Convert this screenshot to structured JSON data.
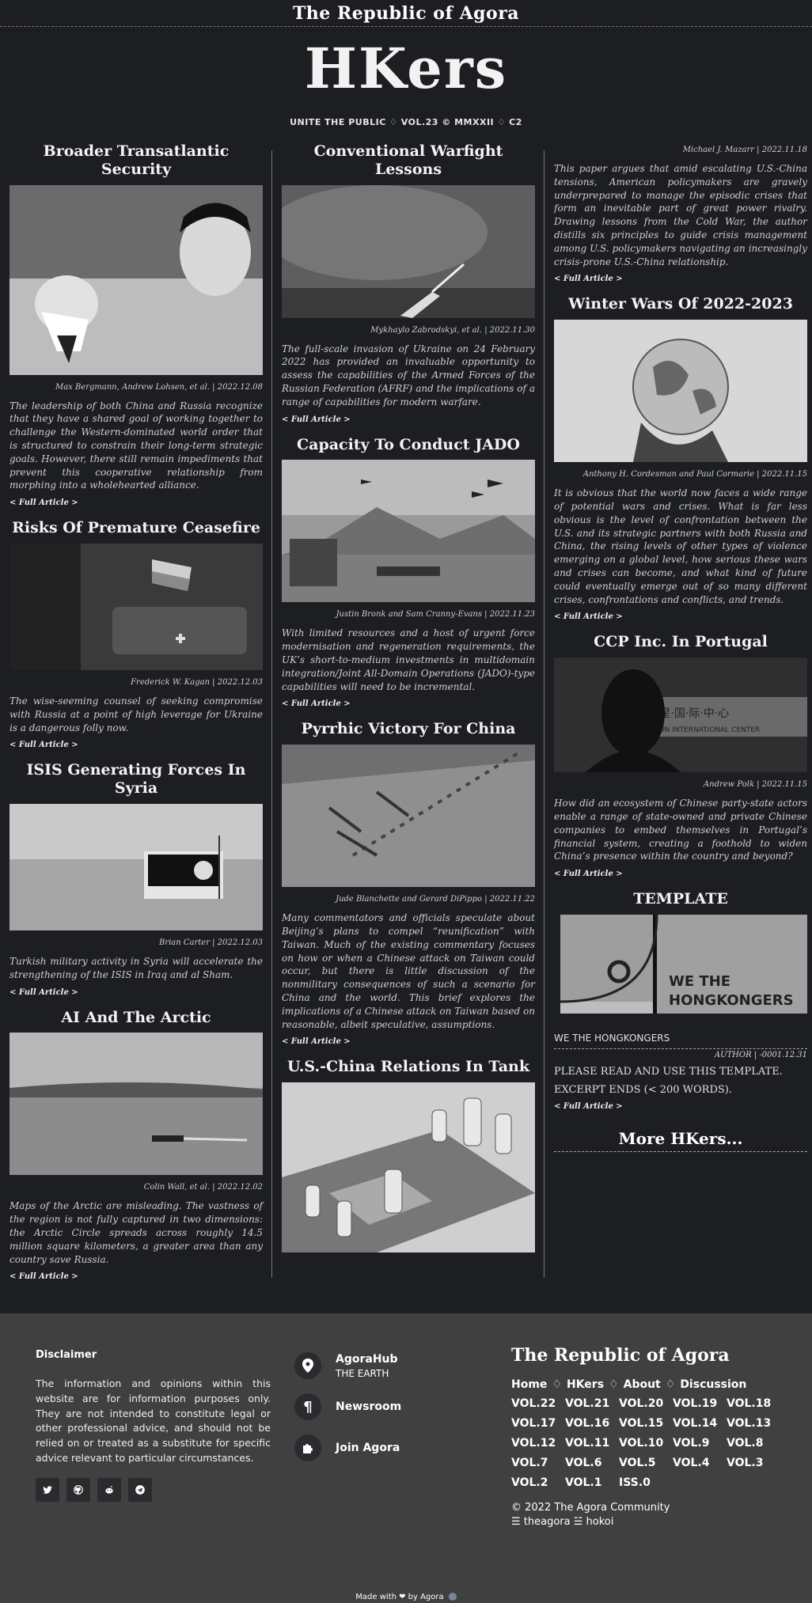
{
  "site": {
    "brand": "The Republic of Agora",
    "logo": "HKers",
    "subtitle": "UNITE THE PUBLIC ♢ VOL.23 © MMXXII ♢ C2"
  },
  "articles": {
    "a1": {
      "title": "Broader Transatlantic Security",
      "byline": "Max Bergmann, Andrew Lohsen, et al. | 2022.12.08",
      "abstract": "The leadership of both China and Russia recognize that they have a shared goal of working together to challenge the Western-dominated world order that is structured to constrain their long-term strategic goals. However, there still remain impediments that prevent this cooperative relationship from morphing into a wholehearted alliance.",
      "more": "< Full Article >"
    },
    "a2": {
      "title": "Risks Of Premature Ceasefire",
      "byline": "Frederick W. Kagan | 2022.12.03",
      "abstract": "The wise-seeming counsel of seeking compromise with Russia at a point of high leverage for Ukraine is a dangerous folly now.",
      "more": "< Full Article >"
    },
    "a3": {
      "title": "ISIS Generating Forces In Syria",
      "byline": "Brian Carter | 2022.12.03",
      "abstract": "Turkish military activity in Syria will accelerate the strengthening of the ISIS in Iraq and al Sham.",
      "more": "< Full Article >"
    },
    "a4": {
      "title": "AI And The Arctic",
      "byline": "Colin Wall, et al. | 2022.12.02",
      "abstract": "Maps of the Arctic are misleading. The vastness of the region is not fully captured in two dimensions: the Arctic Circle spreads across roughly 14.5 million square kilometers, a greater area than any country save Russia.",
      "more": "< Full Article >"
    },
    "b1": {
      "title": "Conventional Warfight Lessons",
      "byline": "Mykhaylo Zabrodskyi, et al. | 2022.11.30",
      "abstract": "The full-scale invasion of Ukraine on 24 February 2022 has provided an invaluable opportunity to assess the capabilities of the Armed Forces of the Russian Federation (AFRF) and the implications of a range of capabilities for modern warfare.",
      "more": "< Full Article >"
    },
    "b2": {
      "title": "Capacity To Conduct JADO",
      "byline": "Justin Bronk and Sam Cranny-Evans | 2022.11.23",
      "abstract": "With limited resources and a host of urgent force modernisation and regeneration requirements, the UK’s short-to-medium investments in multidomain integration/Joint All-Domain Operations (JADO)-type capabilities will need to be incremental.",
      "more": "< Full Article >"
    },
    "b3": {
      "title": "Pyrrhic Victory For China",
      "byline": "Jude Blanchette and Gerard DiPippo | 2022.11.22",
      "abstract": "Many commentators and officials speculate about Beijing’s plans to compel “reunification” with Taiwan. Much of the existing commentary focuses on how or when a Chinese attack on Taiwan could occur, but there is little discussion of the nonmilitary consequences of such a scenario for China and the world. This brief explores the implications of a Chinese attack on Taiwan based on reasonable, albeit speculative, assumptions.",
      "more": "< Full Article >"
    },
    "b4": {
      "title": "U.S.-China Relations In Tank"
    },
    "c0": {
      "byline": "Michael J. Mazarr | 2022.11.18",
      "abstract": "This paper argues that amid escalating U.S.-China tensions, American policymakers are gravely underprepared to manage the episodic crises that form an inevitable part of great power rivalry. Drawing lessons from the Cold War, the author distills six principles to guide crisis management among U.S. policymakers navigating an increasingly crisis-prone U.S.-China relationship.",
      "more": "< Full Article >"
    },
    "c1": {
      "title": "Winter Wars Of 2022-2023",
      "byline": "Anthony H. Cordesman and Paul Cormarie | 2022.11.15",
      "abstract": "It is obvious that the world now faces a wide range of potential wars and crises. What is far less obvious is the level of confrontation between the U.S. and its strategic partners with both Russia and China, the rising levels of other types of violence emerging on a global level, how serious these wars and crises can become, and what kind of future could eventually emerge out of so many different crises, confrontations and conflicts, and trends.",
      "more": "< Full Article >"
    },
    "c2": {
      "title": "CCP Inc. In Portugal",
      "byline": "Andrew Polk | 2022.11.15",
      "abstract": "How did an ecosystem of Chinese party-state actors enable a range of state-owned and private Chinese companies to embed themselves in Portugal’s financial system, creating a foothold to widen China’s presence within the country and beyond?",
      "more": "< Full Article >",
      "sign_cn": "复·星·国·际·中·心",
      "sign_en": "FOSUN INTERNATIONAL CENTER"
    },
    "c3": {
      "title": "TEMPLATE",
      "banner_line1": "WE THE",
      "banner_line2": "HONGKONGERS",
      "caption": "WE THE HONGKONGERS",
      "byline": "AUTHOR | -0001.12.31",
      "p1": "PLEASE READ AND USE THIS TEMPLATE.",
      "p2": "EXCERPT ENDS (< 200 WORDS).",
      "more": "< Full Article >"
    },
    "more_hkers": "More HKers..."
  },
  "footer": {
    "disclaimer_title": "Disclaimer",
    "disclaimer_body": "The information and opinions within this website are for information purposes only. They are not intended to constitute legal or other professional advice, and should not be relied on or treated as a substitute for specific advice relevant to particular circumstances.",
    "links": [
      {
        "label": "AgoraHub",
        "sub": "THE EARTH",
        "icon": "location-pin-icon"
      },
      {
        "label": "Newsroom",
        "icon": "pilcrow-icon"
      },
      {
        "label": "Join Agora",
        "icon": "puzzle-icon"
      }
    ],
    "brand": "The Republic of Agora",
    "nav": [
      "Home",
      "HKers",
      "About",
      "Discussion"
    ],
    "nav_sep": "♢",
    "volumes": [
      "VOL.22",
      "VOL.21",
      "VOL.20",
      "VOL.19",
      "VOL.18",
      "VOL.17",
      "VOL.16",
      "VOL.15",
      "VOL.14",
      "VOL.13",
      "VOL.12",
      "VOL.11",
      "VOL.10",
      "VOL.9",
      "VOL.8",
      "VOL.7",
      "VOL.6",
      "VOL.5",
      "VOL.4",
      "VOL.3",
      "VOL.2",
      "VOL.1",
      "ISS.0"
    ],
    "copyright": "© 2022 The Agora Community",
    "handles": "☰ theagora ☱ hokoi",
    "made_with": "Made with ❤ by Agora"
  }
}
